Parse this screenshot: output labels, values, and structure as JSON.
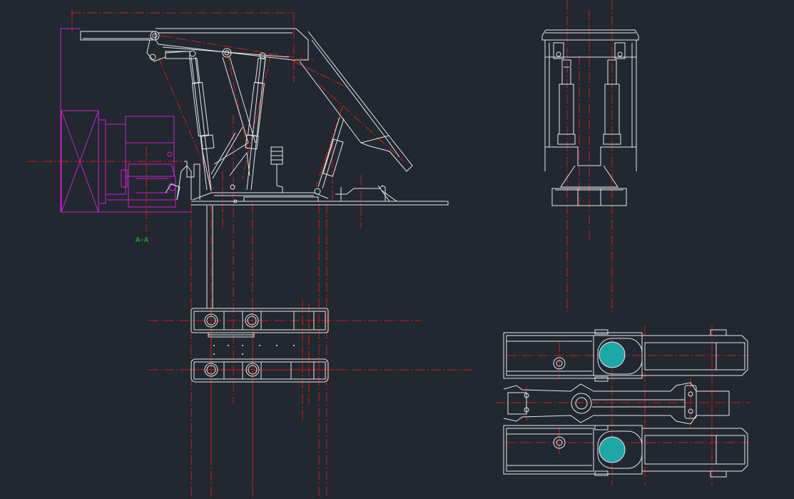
{
  "section_label": "A-A",
  "colors": {
    "background": "#212830",
    "outline": "#e6e6e6",
    "centerline": "#d81818",
    "highlight": "#d21bd2",
    "annotation": "#17d417",
    "section_hatch": "#1ea7a7"
  }
}
